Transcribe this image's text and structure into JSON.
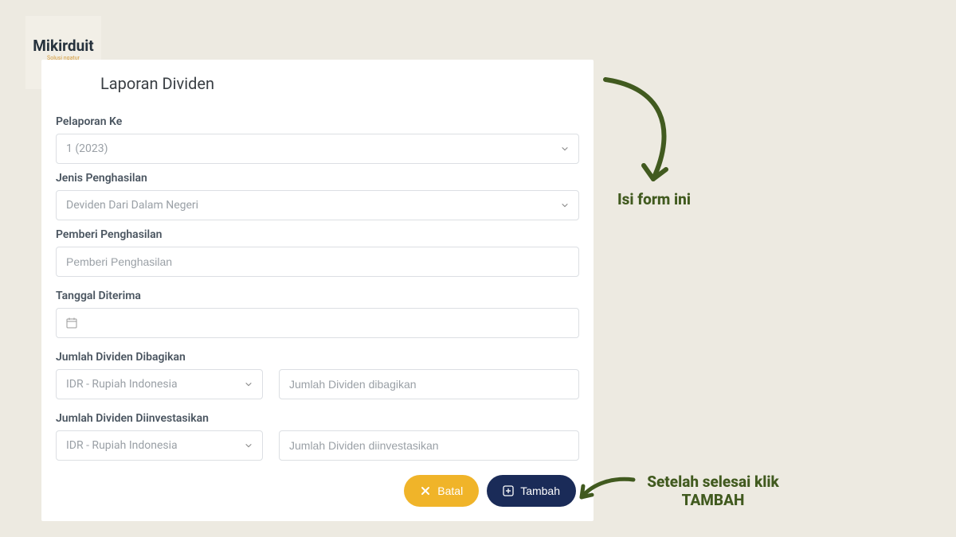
{
  "logo": {
    "title": "Mikirduit",
    "subtitle": "Solusi ngatur\nduit yang cerdas"
  },
  "card": {
    "title": "Laporan Dividen"
  },
  "fields": {
    "pelaporan": {
      "label": "Pelaporan Ke",
      "value": "1 (2023)"
    },
    "jenis": {
      "label": "Jenis Penghasilan",
      "value": "Deviden Dari Dalam Negeri"
    },
    "pemberi": {
      "label": "Pemberi Penghasilan",
      "placeholder": "Pemberi Penghasilan"
    },
    "tanggal": {
      "label": "Tanggal Diterima"
    },
    "dibagikan": {
      "label": "Jumlah Dividen Dibagikan",
      "currency": "IDR - Rupiah Indonesia",
      "placeholder": "Jumlah Dividen dibagikan"
    },
    "diinvestasikan": {
      "label": "Jumlah Dividen Diinvestasikan",
      "currency": "IDR - Rupiah Indonesia",
      "placeholder": "Jumlah Dividen diinvestasikan"
    }
  },
  "buttons": {
    "cancel": "Batal",
    "add": "Tambah"
  },
  "annotations": {
    "fill_form": "Isi form ini",
    "after_done": "Setelah selesai  klik TAMBAH"
  }
}
